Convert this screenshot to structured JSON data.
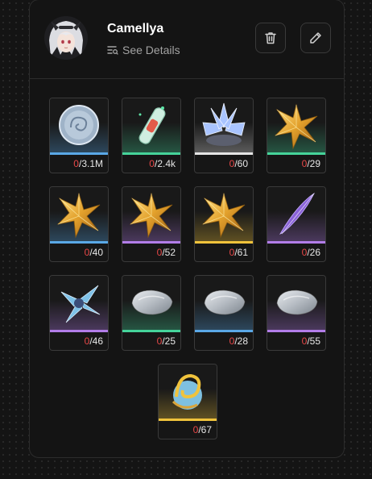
{
  "character": {
    "name": "Camellya",
    "details_label": "See Details"
  },
  "icons": {
    "details": "list-search-icon",
    "delete": "trash-icon",
    "edit": "pencil-icon"
  },
  "rarity_colors": {
    "blue": "#5aa8e6",
    "green": "#45d39a",
    "white": "#e4e4e4",
    "purple": "#b27de8",
    "gold": "#f0c33c"
  },
  "materials": [
    {
      "item": "shell-credit-coin",
      "have": "0",
      "need": "/3.1M",
      "rarity": "blue"
    },
    {
      "item": "vial-item",
      "have": "0",
      "need": "/2.4k",
      "rarity": "green"
    },
    {
      "item": "crystal-flower",
      "have": "0",
      "need": "/60",
      "rarity": "white"
    },
    {
      "item": "gold-star-green",
      "have": "0",
      "need": "/29",
      "rarity": "green"
    },
    {
      "item": "gold-star-blue",
      "have": "0",
      "need": "/40",
      "rarity": "blue"
    },
    {
      "item": "gold-star-purple",
      "have": "0",
      "need": "/52",
      "rarity": "purple"
    },
    {
      "item": "gold-star-gold",
      "have": "0",
      "need": "/61",
      "rarity": "gold"
    },
    {
      "item": "purple-feather",
      "have": "0",
      "need": "/26",
      "rarity": "purple"
    },
    {
      "item": "blue-crystal-cluster",
      "have": "0",
      "need": "/46",
      "rarity": "purple"
    },
    {
      "item": "silver-ingot",
      "have": "0",
      "need": "/25",
      "rarity": "green"
    },
    {
      "item": "bronze-ingot",
      "have": "0",
      "need": "/28",
      "rarity": "blue"
    },
    {
      "item": "iridescent-ingot",
      "have": "0",
      "need": "/55",
      "rarity": "purple"
    },
    {
      "item": "golden-swirl-orb",
      "have": "0",
      "need": "/67",
      "rarity": "gold"
    }
  ]
}
